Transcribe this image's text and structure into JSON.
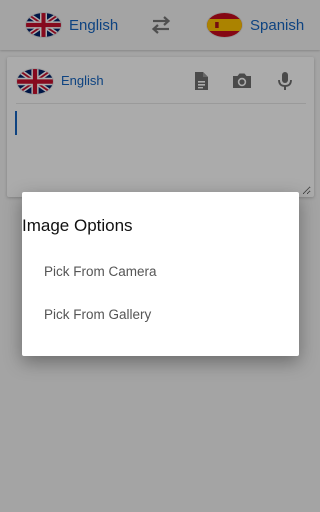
{
  "topbar": {
    "source_lang": "English",
    "target_lang": "Spanish",
    "swap_icon": "swap-horiz-icon",
    "source_flag": "uk-flag-icon",
    "target_flag": "spain-flag-icon"
  },
  "card": {
    "lang": "English",
    "flag": "uk-flag-icon",
    "icons": [
      "document-icon",
      "camera-icon",
      "microphone-icon"
    ],
    "input_value": ""
  },
  "dialog": {
    "title": "Image Options",
    "options": [
      {
        "label": "Pick From Camera"
      },
      {
        "label": "Pick From Gallery"
      }
    ]
  },
  "colors": {
    "accent": "#1565c0",
    "background": "#f5f5f5",
    "dialog_bg": "#ffffff",
    "option_text": "#555555"
  }
}
